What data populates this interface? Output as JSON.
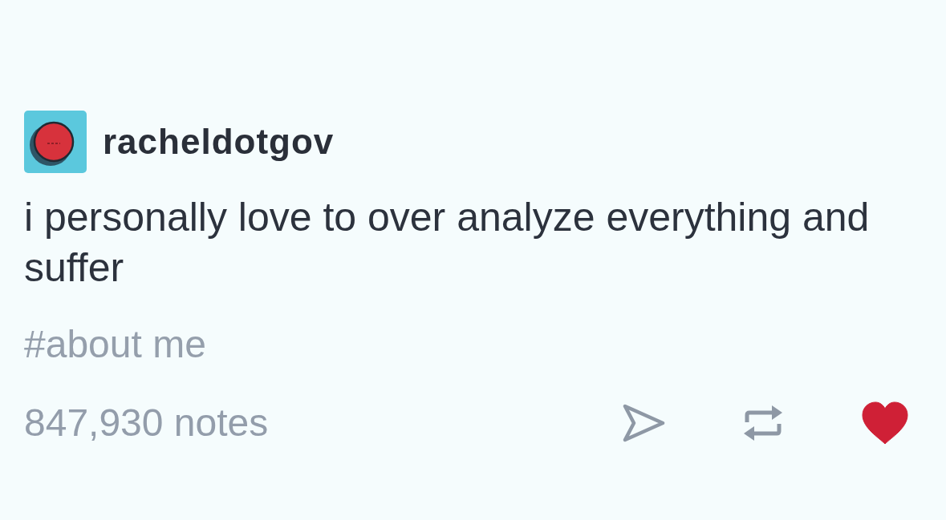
{
  "post": {
    "author": "racheldotgov",
    "text": "i personally love to over analyze everything and suffer",
    "tags": [
      "#about me"
    ],
    "notes": "847,930 notes",
    "liked": true
  }
}
